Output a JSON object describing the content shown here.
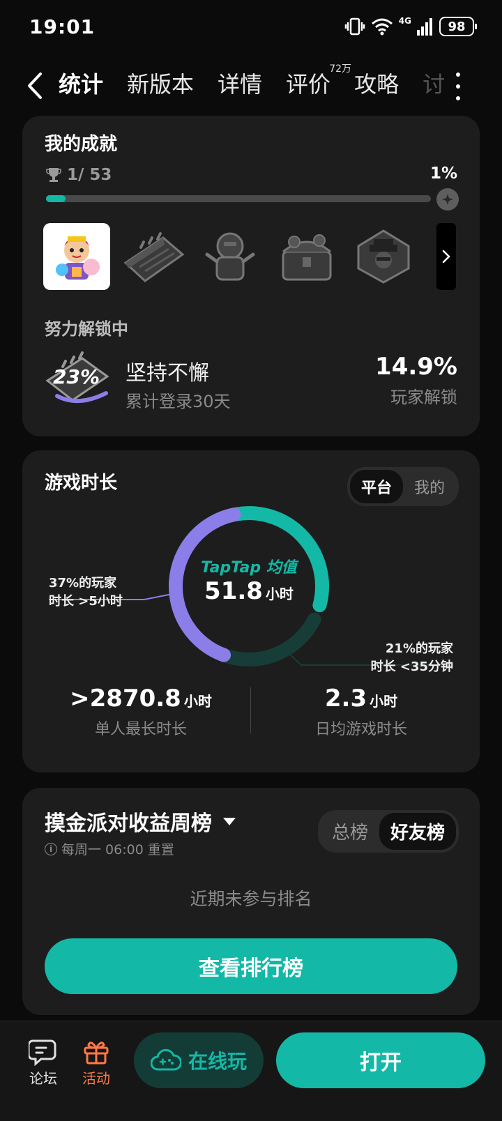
{
  "status_bar": {
    "time": "19:01",
    "network": "4G",
    "battery": "98"
  },
  "nav": {
    "tabs": [
      {
        "label": "统计"
      },
      {
        "label": "新版本"
      },
      {
        "label": "详情"
      },
      {
        "label": "评价",
        "badge": "72万"
      },
      {
        "label": "攻略"
      },
      {
        "label": "讨"
      }
    ]
  },
  "achievements": {
    "title": "我的成就",
    "count": "1/ 53",
    "percent": "1%",
    "progress_fraction": 0.05,
    "unlocking_title": "努力解锁中",
    "unlocking": {
      "icon_percent": "23%",
      "name": "坚持不懈",
      "desc": "累计登录30天",
      "pct": "14.9%",
      "pct_label": "玩家解锁"
    }
  },
  "playtime": {
    "title": "游戏时长",
    "toggle": {
      "platform": "平台",
      "mine": "我的"
    },
    "center_label": "TapTap 均值",
    "center_value": "51.8",
    "center_unit": "小时",
    "ann_left_line1": "37%的玩家",
    "ann_left_line2": "时长 >5小时",
    "ann_right_line1": "21%的玩家",
    "ann_right_line2": "时长 <35分钟",
    "segments": {
      "long": 0.37,
      "short": 0.21
    },
    "stat_left": {
      "value": ">2870.8",
      "unit": "小时",
      "label": "单人最长时长"
    },
    "stat_right": {
      "value": "2.3",
      "unit": "小时",
      "label": "日均游戏时长"
    },
    "colors": {
      "teal": "#14b8a6",
      "purple": "#8b7ee8",
      "dark_teal": "#173d38"
    }
  },
  "ranking": {
    "title": "摸金派对收益周榜",
    "reset": "每周一 06:00 重置",
    "toggle": {
      "all": "总榜",
      "friends": "好友榜"
    },
    "empty": "近期未参与排名",
    "button": "查看排行榜"
  },
  "bottom": {
    "forum": "论坛",
    "event": "活动",
    "cloud": "在线玩",
    "open": "打开"
  }
}
